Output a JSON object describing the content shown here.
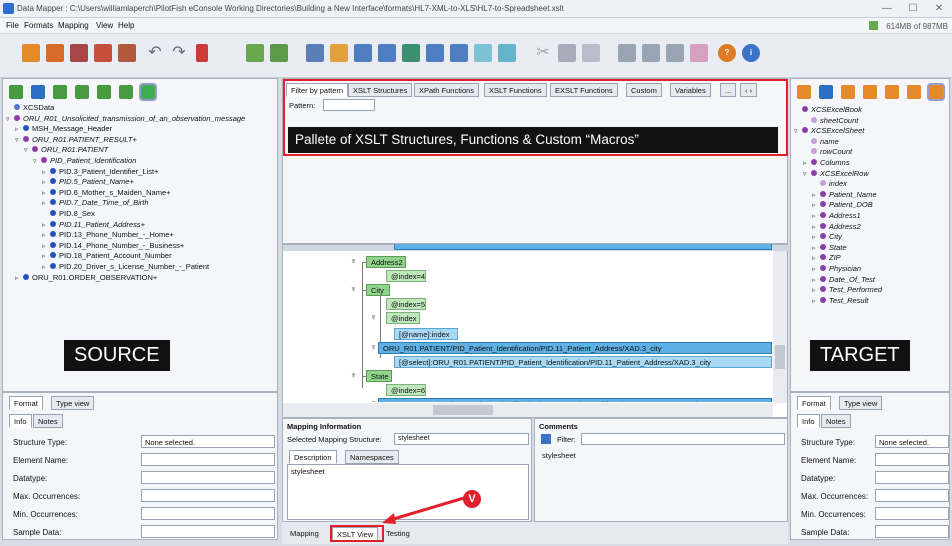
{
  "window": {
    "title": "Data Mapper : C:\\Users\\williamlaperch\\PilotFish eConsole Working Directories\\Building a New Interface\\formats\\HL7-XML-to-XLS\\HL7-to-Spreadsheet.xslt",
    "min": "—",
    "max": "☐",
    "close": "✕"
  },
  "menu": {
    "file": "File",
    "formats": "Formats",
    "mapping": "Mapping",
    "view": "View",
    "help": "Help",
    "memory": "614MB of 987MB"
  },
  "source": {
    "tree": [
      {
        "label": "XCSData",
        "indent": 0,
        "exp": "",
        "color": "#5577cc",
        "italic": false
      },
      {
        "label": "ORU_R01_Unsolicited_transmission_of_an_observation_message",
        "indent": 0,
        "exp": "▿",
        "color": "#8b3ea8",
        "italic": true
      },
      {
        "label": "MSH_Message_Header",
        "indent": 1,
        "exp": "▹",
        "color": "#2255bb",
        "italic": false
      },
      {
        "label": "ORU_R01.PATIENT_RESULT+",
        "indent": 1,
        "exp": "▿",
        "color": "#8b3ea8",
        "italic": true
      },
      {
        "label": "ORU_R01.PATIENT",
        "indent": 2,
        "exp": "▿",
        "color": "#8b3ea8",
        "italic": true
      },
      {
        "label": "PID_Patient_Identification",
        "indent": 3,
        "exp": "▿",
        "color": "#8b3ea8",
        "italic": true
      },
      {
        "label": "PID.3_Patient_Identifier_List+",
        "indent": 4,
        "exp": "▹",
        "color": "#2255bb",
        "italic": false
      },
      {
        "label": "PID.5_Patient_Name+",
        "indent": 4,
        "exp": "▹",
        "color": "#2255bb",
        "italic": true
      },
      {
        "label": "PID.6_Mother_s_Maiden_Name+",
        "indent": 4,
        "exp": "▹",
        "color": "#2255bb",
        "italic": false
      },
      {
        "label": "PID.7_Date_Time_of_Birth",
        "indent": 4,
        "exp": "▹",
        "color": "#2255bb",
        "italic": true
      },
      {
        "label": "PID.8_Sex",
        "indent": 4,
        "exp": "",
        "color": "#2255bb",
        "italic": false
      },
      {
        "label": "PID.11_Patient_Address+",
        "indent": 4,
        "exp": "▹",
        "color": "#2255bb",
        "italic": true
      },
      {
        "label": "PID.13_Phone_Number_-_Home+",
        "indent": 4,
        "exp": "▹",
        "color": "#2255bb",
        "italic": false
      },
      {
        "label": "PID.14_Phone_Number_-_Business+",
        "indent": 4,
        "exp": "▹",
        "color": "#2255bb",
        "italic": false
      },
      {
        "label": "PID.18_Patient_Account_Number",
        "indent": 4,
        "exp": "▹",
        "color": "#2255bb",
        "italic": false
      },
      {
        "label": "PID.20_Driver_s_License_Number_-_Patient",
        "indent": 4,
        "exp": "▹",
        "color": "#2255bb",
        "italic": false
      },
      {
        "label": "ORU_R01.ORDER_OBSERVATION+",
        "indent": 1,
        "exp": "▹",
        "color": "#2255bb",
        "italic": false
      }
    ],
    "banner": "SOURCE",
    "tabs": {
      "format": "Format",
      "type_view": "Type view",
      "info": "Info",
      "notes": "Notes"
    },
    "props": {
      "structure_type": "Structure Type:",
      "structure_value": "None selected.",
      "element_name": "Element Name:",
      "datatype": "Datatype:",
      "max_occ": "Max. Occurrences:",
      "min_occ": "Min. Occurrences:",
      "sample": "Sample Data:"
    }
  },
  "palette": {
    "tabs": [
      "Filter by pattern",
      "XSLT Structures",
      "XPath Functions",
      "XSLT Functions",
      "EXSLT Functions",
      "Custom",
      "Variables"
    ],
    "more": "...",
    "pattern_label": "Pattern:",
    "caption": "Pallete of XSLT Structures, Functions & Custom “Macros”"
  },
  "xslt": {
    "nodes": [
      {
        "label": "Address2",
        "cls": "n-green"
      },
      {
        "label": "@index=4",
        "cls": "n-lgreen"
      },
      {
        "label": "City",
        "cls": "n-green"
      },
      {
        "label": "@index=5",
        "cls": "n-lgreen"
      },
      {
        "label": "@index",
        "cls": "n-lgreen"
      },
      {
        "label": "[@name]:index",
        "cls": "n-lblue"
      },
      {
        "label": "ORU_R01.PATIENT/PID_Patient_Identification/PID.11_Patient_Address/XAD.3_city",
        "cls": "n-blue"
      },
      {
        "label": "[@select]:ORU_R01.PATIENT/PID_Patient_Identification/PID.11_Patient_Address/XAD.3_city",
        "cls": "n-lblue"
      },
      {
        "label": "State",
        "cls": "n-green"
      },
      {
        "label": "@index=6",
        "cls": "n-lgreen"
      },
      {
        "label": "ORU_R01.PATIENT/PID_Patient_Identification/PID.11_Patient_Address/XAD.4_state_or_province",
        "cls": "n-blue"
      },
      {
        "label": "[@select]:ORU_R01.PATIENT/PID_Patient_Identification/PID.11_Patient_Address/XAD.4_state_or_prov",
        "cls": "n-lblue"
      }
    ]
  },
  "mapping_info": {
    "title": "Mapping Information",
    "selected_label": "Selected Mapping Structure:",
    "selected_value": "stylesheet",
    "tab_description": "Description",
    "tab_namespaces": "Namespaces",
    "description_text": "stylesheet"
  },
  "comments": {
    "title": "Comments",
    "filter_label": "Filter:",
    "text": "stylesheet"
  },
  "bottom_tabs": {
    "mapping": "Mapping",
    "xslt_view": "XSLT View",
    "testing": "Testing"
  },
  "marker": "V",
  "target": {
    "tree": [
      {
        "label": "XCSExcelBook",
        "indent": 0,
        "exp": "",
        "color": "#8b3ea8",
        "italic": true
      },
      {
        "label": "sheetCount",
        "indent": 1,
        "exp": "",
        "color": "#c8a0d8",
        "italic": true
      },
      {
        "label": "XCSExcelSheet",
        "indent": 0,
        "exp": "▿",
        "color": "#8b3ea8",
        "italic": true
      },
      {
        "label": "name",
        "indent": 1,
        "exp": "",
        "color": "#c8a0d8",
        "italic": true
      },
      {
        "label": "rowCount",
        "indent": 1,
        "exp": "",
        "color": "#c8a0d8",
        "italic": true
      },
      {
        "label": "Columns",
        "indent": 1,
        "exp": "▹",
        "color": "#8b3ea8",
        "italic": true
      },
      {
        "label": "XCSExcelRow",
        "indent": 1,
        "exp": "▿",
        "color": "#8b3ea8",
        "italic": true
      },
      {
        "label": "index",
        "indent": 2,
        "exp": "",
        "color": "#c8a0d8",
        "italic": true
      },
      {
        "label": "Patient_Name",
        "indent": 2,
        "exp": "▹",
        "color": "#8b3ea8",
        "italic": true
      },
      {
        "label": "Patient_DOB",
        "indent": 2,
        "exp": "▹",
        "color": "#8b3ea8",
        "italic": true
      },
      {
        "label": "Address1",
        "indent": 2,
        "exp": "▹",
        "color": "#8b3ea8",
        "italic": true
      },
      {
        "label": "Address2",
        "indent": 2,
        "exp": "▹",
        "color": "#8b3ea8",
        "italic": true
      },
      {
        "label": "City",
        "indent": 2,
        "exp": "▹",
        "color": "#8b3ea8",
        "italic": true
      },
      {
        "label": "State",
        "indent": 2,
        "exp": "▹",
        "color": "#8b3ea8",
        "italic": true
      },
      {
        "label": "ZIP",
        "indent": 2,
        "exp": "▹",
        "color": "#8b3ea8",
        "italic": true
      },
      {
        "label": "Physician",
        "indent": 2,
        "exp": "▹",
        "color": "#8b3ea8",
        "italic": true
      },
      {
        "label": "Date_Of_Test",
        "indent": 2,
        "exp": "▹",
        "color": "#8b3ea8",
        "italic": true
      },
      {
        "label": "Test_Performed",
        "indent": 2,
        "exp": "▹",
        "color": "#8b3ea8",
        "italic": true
      },
      {
        "label": "Test_Result",
        "indent": 2,
        "exp": "▹",
        "color": "#8b3ea8",
        "italic": true
      }
    ],
    "banner": "TARGET",
    "tabs": {
      "format": "Format",
      "type_view": "Type view",
      "info": "Info",
      "notes": "Notes"
    },
    "props": {
      "structure_type": "Structure Type:",
      "structure_value": "None selected.",
      "element_name": "Element Name:",
      "datatype": "Datatype:",
      "max_occ": "Max. Occurrences:",
      "min_occ": "Min. Occurrences:",
      "sample": "Sample Data:"
    }
  },
  "colors": {
    "highlight": "#e0202a",
    "accent": "#2f6fd0"
  }
}
